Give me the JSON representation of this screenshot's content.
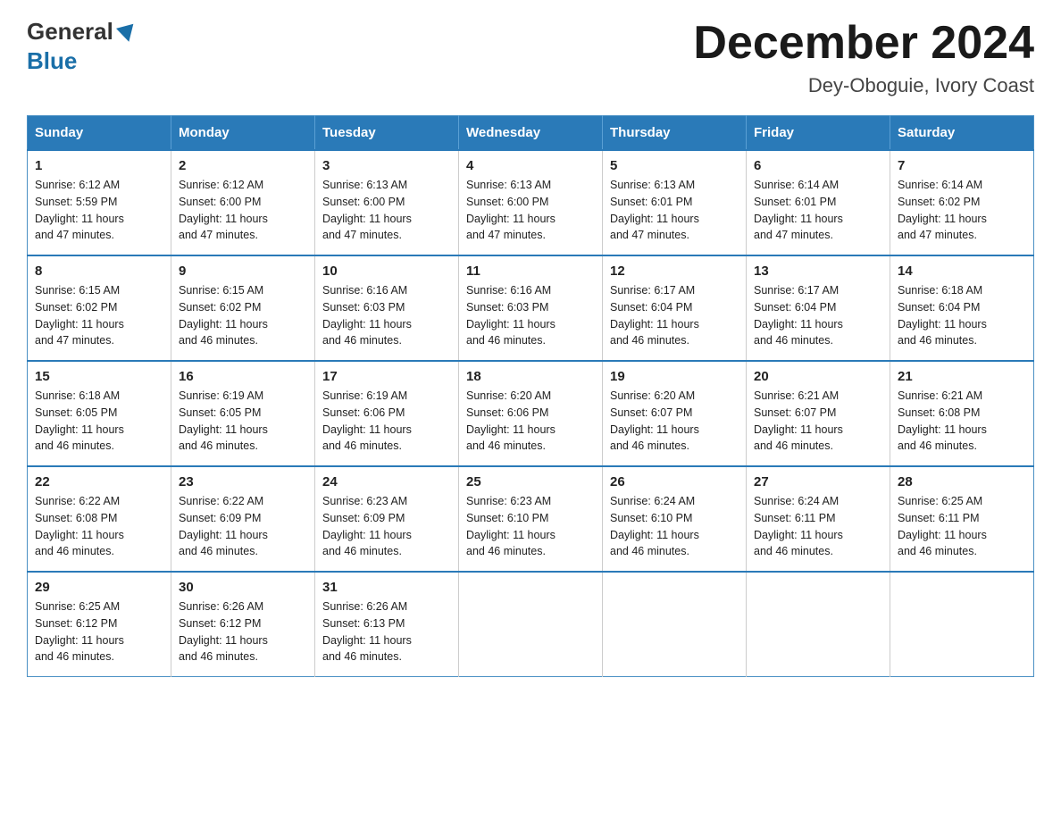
{
  "logo": {
    "general": "General",
    "blue": "Blue"
  },
  "title": "December 2024",
  "subtitle": "Dey-Oboguie, Ivory Coast",
  "days_of_week": [
    "Sunday",
    "Monday",
    "Tuesday",
    "Wednesday",
    "Thursday",
    "Friday",
    "Saturday"
  ],
  "weeks": [
    [
      {
        "day": "1",
        "sunrise": "6:12 AM",
        "sunset": "5:59 PM",
        "daylight": "11 hours and 47 minutes."
      },
      {
        "day": "2",
        "sunrise": "6:12 AM",
        "sunset": "6:00 PM",
        "daylight": "11 hours and 47 minutes."
      },
      {
        "day": "3",
        "sunrise": "6:13 AM",
        "sunset": "6:00 PM",
        "daylight": "11 hours and 47 minutes."
      },
      {
        "day": "4",
        "sunrise": "6:13 AM",
        "sunset": "6:00 PM",
        "daylight": "11 hours and 47 minutes."
      },
      {
        "day": "5",
        "sunrise": "6:13 AM",
        "sunset": "6:01 PM",
        "daylight": "11 hours and 47 minutes."
      },
      {
        "day": "6",
        "sunrise": "6:14 AM",
        "sunset": "6:01 PM",
        "daylight": "11 hours and 47 minutes."
      },
      {
        "day": "7",
        "sunrise": "6:14 AM",
        "sunset": "6:02 PM",
        "daylight": "11 hours and 47 minutes."
      }
    ],
    [
      {
        "day": "8",
        "sunrise": "6:15 AM",
        "sunset": "6:02 PM",
        "daylight": "11 hours and 47 minutes."
      },
      {
        "day": "9",
        "sunrise": "6:15 AM",
        "sunset": "6:02 PM",
        "daylight": "11 hours and 46 minutes."
      },
      {
        "day": "10",
        "sunrise": "6:16 AM",
        "sunset": "6:03 PM",
        "daylight": "11 hours and 46 minutes."
      },
      {
        "day": "11",
        "sunrise": "6:16 AM",
        "sunset": "6:03 PM",
        "daylight": "11 hours and 46 minutes."
      },
      {
        "day": "12",
        "sunrise": "6:17 AM",
        "sunset": "6:04 PM",
        "daylight": "11 hours and 46 minutes."
      },
      {
        "day": "13",
        "sunrise": "6:17 AM",
        "sunset": "6:04 PM",
        "daylight": "11 hours and 46 minutes."
      },
      {
        "day": "14",
        "sunrise": "6:18 AM",
        "sunset": "6:04 PM",
        "daylight": "11 hours and 46 minutes."
      }
    ],
    [
      {
        "day": "15",
        "sunrise": "6:18 AM",
        "sunset": "6:05 PM",
        "daylight": "11 hours and 46 minutes."
      },
      {
        "day": "16",
        "sunrise": "6:19 AM",
        "sunset": "6:05 PM",
        "daylight": "11 hours and 46 minutes."
      },
      {
        "day": "17",
        "sunrise": "6:19 AM",
        "sunset": "6:06 PM",
        "daylight": "11 hours and 46 minutes."
      },
      {
        "day": "18",
        "sunrise": "6:20 AM",
        "sunset": "6:06 PM",
        "daylight": "11 hours and 46 minutes."
      },
      {
        "day": "19",
        "sunrise": "6:20 AM",
        "sunset": "6:07 PM",
        "daylight": "11 hours and 46 minutes."
      },
      {
        "day": "20",
        "sunrise": "6:21 AM",
        "sunset": "6:07 PM",
        "daylight": "11 hours and 46 minutes."
      },
      {
        "day": "21",
        "sunrise": "6:21 AM",
        "sunset": "6:08 PM",
        "daylight": "11 hours and 46 minutes."
      }
    ],
    [
      {
        "day": "22",
        "sunrise": "6:22 AM",
        "sunset": "6:08 PM",
        "daylight": "11 hours and 46 minutes."
      },
      {
        "day": "23",
        "sunrise": "6:22 AM",
        "sunset": "6:09 PM",
        "daylight": "11 hours and 46 minutes."
      },
      {
        "day": "24",
        "sunrise": "6:23 AM",
        "sunset": "6:09 PM",
        "daylight": "11 hours and 46 minutes."
      },
      {
        "day": "25",
        "sunrise": "6:23 AM",
        "sunset": "6:10 PM",
        "daylight": "11 hours and 46 minutes."
      },
      {
        "day": "26",
        "sunrise": "6:24 AM",
        "sunset": "6:10 PM",
        "daylight": "11 hours and 46 minutes."
      },
      {
        "day": "27",
        "sunrise": "6:24 AM",
        "sunset": "6:11 PM",
        "daylight": "11 hours and 46 minutes."
      },
      {
        "day": "28",
        "sunrise": "6:25 AM",
        "sunset": "6:11 PM",
        "daylight": "11 hours and 46 minutes."
      }
    ],
    [
      {
        "day": "29",
        "sunrise": "6:25 AM",
        "sunset": "6:12 PM",
        "daylight": "11 hours and 46 minutes."
      },
      {
        "day": "30",
        "sunrise": "6:26 AM",
        "sunset": "6:12 PM",
        "daylight": "11 hours and 46 minutes."
      },
      {
        "day": "31",
        "sunrise": "6:26 AM",
        "sunset": "6:13 PM",
        "daylight": "11 hours and 46 minutes."
      },
      null,
      null,
      null,
      null
    ]
  ],
  "labels": {
    "sunrise": "Sunrise:",
    "sunset": "Sunset:",
    "daylight": "Daylight:"
  }
}
